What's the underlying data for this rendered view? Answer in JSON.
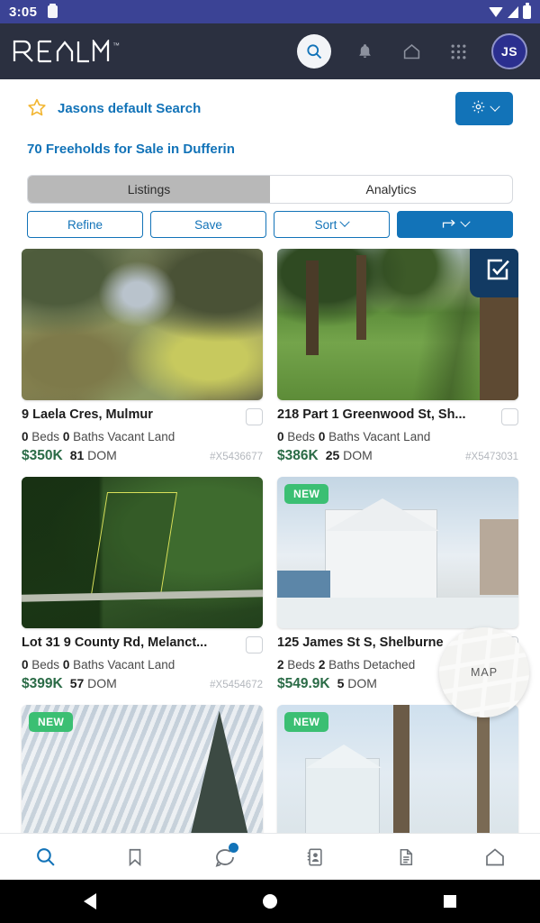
{
  "statusbar": {
    "time": "3:05",
    "icons": [
      "clipboard-icon",
      "wifi-icon",
      "signal-icon",
      "battery-icon"
    ]
  },
  "appbar": {
    "logo_text": "REALM",
    "logo_tm": "™",
    "icons": [
      "search-icon",
      "bell-icon",
      "home-icon",
      "apps-grid-icon"
    ],
    "avatar_initials": "JS"
  },
  "saved_search": {
    "star_icon": "star-outline-icon",
    "name": "Jasons default Search",
    "settings_icon": "gear-icon",
    "settings_chevron": "chevron-down-icon"
  },
  "result_title": "70 Freeholds for Sale in Dufferin",
  "tabs": [
    {
      "label": "Listings",
      "active": true
    },
    {
      "label": "Analytics",
      "active": false
    }
  ],
  "actions": [
    {
      "label": "Refine",
      "primary": false,
      "chevron": false
    },
    {
      "label": "Save",
      "primary": false,
      "chevron": false
    },
    {
      "label": "Sort",
      "primary": false,
      "chevron": true
    },
    {
      "label": "",
      "primary": true,
      "chevron": true,
      "icon": "share-arrow-icon"
    }
  ],
  "listings": [
    {
      "address": "9 Laela Cres, Mulmur",
      "beds": "0",
      "beds_label": "Beds",
      "baths": "0",
      "baths_label": "Baths",
      "type": "Vacant Land",
      "price": "$350K",
      "dom": "81",
      "dom_label": "DOM",
      "mls": "#X5436677",
      "badge": "",
      "selected_overlay": false
    },
    {
      "address": "218 Part 1 Greenwood St, Sh...",
      "beds": "0",
      "beds_label": "Beds",
      "baths": "0",
      "baths_label": "Baths",
      "type": "Vacant Land",
      "price": "$386K",
      "dom": "25",
      "dom_label": "DOM",
      "mls": "#X5473031",
      "badge": "",
      "selected_overlay": true
    },
    {
      "address": "Lot 31 9 County Rd, Melanct...",
      "beds": "0",
      "beds_label": "Beds",
      "baths": "0",
      "baths_label": "Baths",
      "type": "Vacant Land",
      "price": "$399K",
      "dom": "57",
      "dom_label": "DOM",
      "mls": "#X5454672",
      "badge": "",
      "selected_overlay": false
    },
    {
      "address": "125 James St S, Shelburne",
      "beds": "2",
      "beds_label": "Beds",
      "baths": "2",
      "baths_label": "Baths",
      "type": "Detached",
      "price": "$549.9K",
      "dom": "5",
      "dom_label": "DOM",
      "mls": "",
      "badge": "NEW",
      "selected_overlay": false
    },
    {
      "address": "",
      "badge": "NEW",
      "partial": true
    },
    {
      "address": "",
      "badge": "NEW",
      "partial": true
    }
  ],
  "map_fab": {
    "label": "MAP"
  },
  "bottomnav": {
    "items": [
      {
        "name": "search-icon",
        "active": true,
        "dot": false
      },
      {
        "name": "bookmark-icon",
        "active": false,
        "dot": false
      },
      {
        "name": "chat-bubble-icon",
        "active": false,
        "dot": true
      },
      {
        "name": "contacts-book-icon",
        "active": false,
        "dot": false
      },
      {
        "name": "document-icon",
        "active": false,
        "dot": false
      },
      {
        "name": "home-icon",
        "active": false,
        "dot": false
      }
    ]
  },
  "sysnav": {
    "back": "back-triangle-icon",
    "home": "home-circle-icon",
    "recents": "recents-square-icon"
  },
  "colors": {
    "status_bar": "#3b4395",
    "app_bar": "#2b3040",
    "accent_blue": "#1273b8",
    "price_green": "#2a6b46",
    "badge_green": "#3bbf73",
    "overlay_navy": "#123a63",
    "tab_active_gray": "#b8b8b8"
  }
}
